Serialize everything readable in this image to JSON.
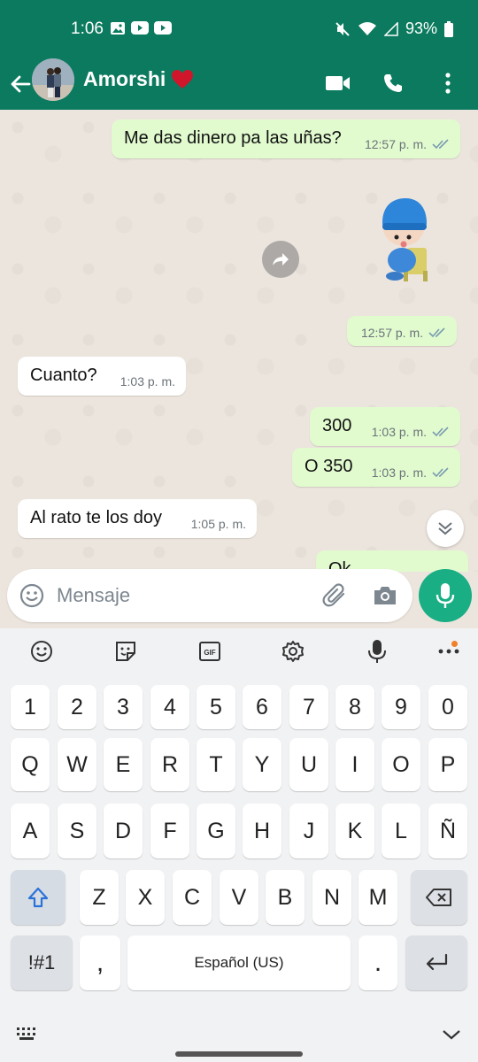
{
  "status_bar": {
    "time": "1:06",
    "battery": "93%",
    "left_icons": [
      "gallery-icon",
      "youtube-icon",
      "youtube-icon"
    ],
    "right_icons": [
      "mute-icon",
      "wifi-icon",
      "signal-icon",
      "battery-icon"
    ]
  },
  "header": {
    "contact_name": "Amorshi",
    "name_emoji": "heart-icon",
    "actions": [
      "video-call-icon",
      "phone-call-icon",
      "more-options-icon"
    ],
    "accent_color": "#0B7A5E"
  },
  "messages": [
    {
      "direction": "out",
      "text": "Me das dinero pa las uñas?",
      "time": "12:57 p. m.",
      "read": true
    },
    {
      "direction": "out",
      "type": "sticker",
      "text": "",
      "time": "12:57 p. m.",
      "read": true
    },
    {
      "direction": "in",
      "text": "Cuanto?",
      "time": "1:03 p. m."
    },
    {
      "direction": "out",
      "text": "300",
      "time": "1:03 p. m.",
      "read": true
    },
    {
      "direction": "out",
      "text": "O 350",
      "time": "1:03 p. m.",
      "read": true
    },
    {
      "direction": "in",
      "text": "Al rato te los doy",
      "time": "1:05 p. m."
    },
    {
      "direction": "out",
      "text": "Ok",
      "time": "",
      "partial": true
    }
  ],
  "composer": {
    "placeholder": "Mensaje"
  },
  "keyboard": {
    "toolbar": [
      "emoji-icon",
      "sticker-icon",
      "gif-icon",
      "settings-icon",
      "voice-input-icon",
      "more-icon"
    ],
    "row1": [
      "1",
      "2",
      "3",
      "4",
      "5",
      "6",
      "7",
      "8",
      "9",
      "0"
    ],
    "row2": [
      "Q",
      "W",
      "E",
      "R",
      "T",
      "Y",
      "U",
      "I",
      "O",
      "P"
    ],
    "row3": [
      "A",
      "S",
      "D",
      "F",
      "G",
      "H",
      "J",
      "K",
      "L",
      "Ñ"
    ],
    "row4": [
      "Z",
      "X",
      "C",
      "V",
      "B",
      "N",
      "M"
    ],
    "symbols_label": "!#1",
    "comma": ",",
    "space_label": "Español (US)",
    "period": "."
  },
  "colors": {
    "outgoing_bubble": "#E1FBCF",
    "incoming_bubble": "#FFFFFF",
    "chat_bg": "#ECE5DD",
    "send_button": "#1AAE85",
    "read_ticks": "#53BDEB"
  }
}
